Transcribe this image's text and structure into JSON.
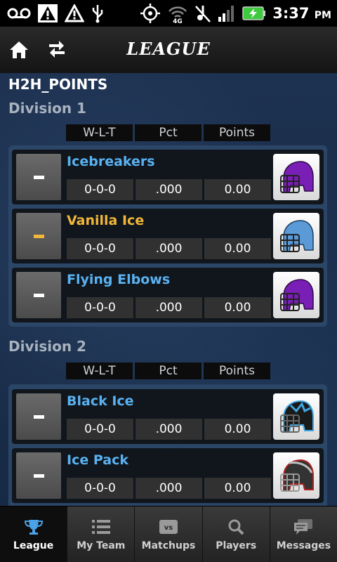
{
  "status_bar": {
    "time": "3:37",
    "ampm": "PM",
    "icons": [
      "voicemail-icon",
      "warning-icon",
      "warning-outline-icon",
      "usb-icon",
      "gps-icon",
      "wifi-4g-icon",
      "silent-icon",
      "signal-icon",
      "battery-charging-icon"
    ]
  },
  "header": {
    "title": "LEAGUE",
    "home_icon": "home-icon",
    "switch_icon": "swap-arrows-icon"
  },
  "league": {
    "name": "H2H_POINTS",
    "columns": [
      "W-L-T",
      "Pct",
      "Points"
    ],
    "divisions": [
      {
        "title": "Division 1",
        "teams": [
          {
            "rank": "-",
            "name": "Icebreakers",
            "wlt": "0-0-0",
            "pct": ".000",
            "points": "0.00",
            "helmet_color": "#7a1fb5",
            "is_user": false
          },
          {
            "rank": "-",
            "name": "Vanilla Ice",
            "wlt": "0-0-0",
            "pct": ".000",
            "points": "0.00",
            "helmet_color": "#5a9ad6",
            "is_user": true
          },
          {
            "rank": "-",
            "name": "Flying Elbows",
            "wlt": "0-0-0",
            "pct": ".000",
            "points": "0.00",
            "helmet_color": "#7a1fb5",
            "is_user": false
          }
        ]
      },
      {
        "title": "Division 2",
        "teams": [
          {
            "rank": "-",
            "name": "Black Ice",
            "wlt": "0-0-0",
            "pct": ".000",
            "points": "0.00",
            "helmet_color": "#1a1a1a",
            "is_user": false
          },
          {
            "rank": "-",
            "name": "Ice Pack",
            "wlt": "0-0-0",
            "pct": ".000",
            "points": "0.00",
            "helmet_color": "#333333",
            "is_user": false
          }
        ]
      }
    ]
  },
  "bottom_nav": [
    {
      "label": "League",
      "icon": "trophy-icon",
      "active": true
    },
    {
      "label": "My Team",
      "icon": "list-icon",
      "active": false
    },
    {
      "label": "Matchups",
      "icon": "vs-icon",
      "active": false
    },
    {
      "label": "Players",
      "icon": "search-icon",
      "active": false
    },
    {
      "label": "Messages",
      "icon": "chat-icon",
      "active": false
    }
  ],
  "colors": {
    "team_link": "#5ab2f2",
    "user_team": "#f2b63a"
  }
}
